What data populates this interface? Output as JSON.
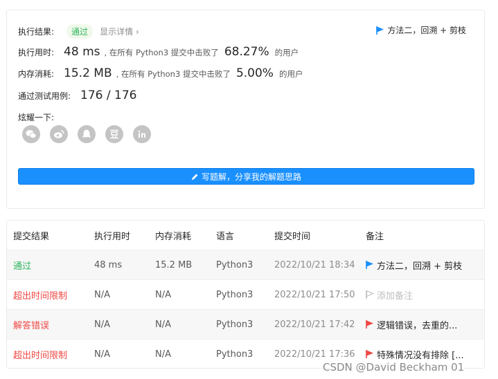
{
  "summary": {
    "status_label": "执行结果:",
    "status_value": "通过",
    "detail_link": "显示详情 ›",
    "note": "方法二，回溯 + 剪枝",
    "runtime_label": "执行用时:",
    "runtime_value": "48 ms",
    "runtime_mid": ", 在所有 Python3 提交中击败了",
    "runtime_pct": "68.27%",
    "runtime_tail": "的用户",
    "memory_label": "内存消耗:",
    "memory_value": "15.2 MB",
    "memory_mid": ", 在所有 Python3 提交中击败了",
    "memory_pct": "5.00%",
    "memory_tail": "的用户",
    "tests_label": "通过测试用例:",
    "tests_value": "176 / 176",
    "share_label": "炫耀一下:",
    "write_button": "写题解，分享我的解题思路"
  },
  "share_icons": [
    "wechat-icon",
    "weibo-icon",
    "qq-icon",
    "douban-icon",
    "linkedin-icon"
  ],
  "table": {
    "headers": [
      "提交结果",
      "执行用时",
      "内存消耗",
      "语言",
      "提交时间",
      "备注"
    ],
    "rows": [
      {
        "result": "通过",
        "time": "48 ms",
        "memory": "15.2 MB",
        "lang": "Python3",
        "submitted": "2022/10/21 18:34",
        "note": "方法二，回溯 + 剪枝"
      },
      {
        "result": "超出时间限制",
        "time": "N/A",
        "memory": "N/A",
        "lang": "Python3",
        "submitted": "2022/10/21 17:50",
        "note": "添加备注"
      },
      {
        "result": "解答错误",
        "time": "N/A",
        "memory": "N/A",
        "lang": "Python3",
        "submitted": "2022/10/21 17:42",
        "note": "逻辑错误，去重的..."
      },
      {
        "result": "超出时间限制",
        "time": "N/A",
        "memory": "N/A",
        "lang": "Python3",
        "submitted": "2022/10/21 17:36",
        "note": "特殊情况没有排除 [..."
      }
    ]
  },
  "colors": {
    "accent": "#1a90ff",
    "pass": "#2db55d",
    "fail": "#ef4743",
    "flag_blue": "#1a90ff",
    "flag_red": "#ef4743",
    "flag_gray": "#bfbfbf"
  },
  "watermark": "CSDN @David Beckham 01"
}
